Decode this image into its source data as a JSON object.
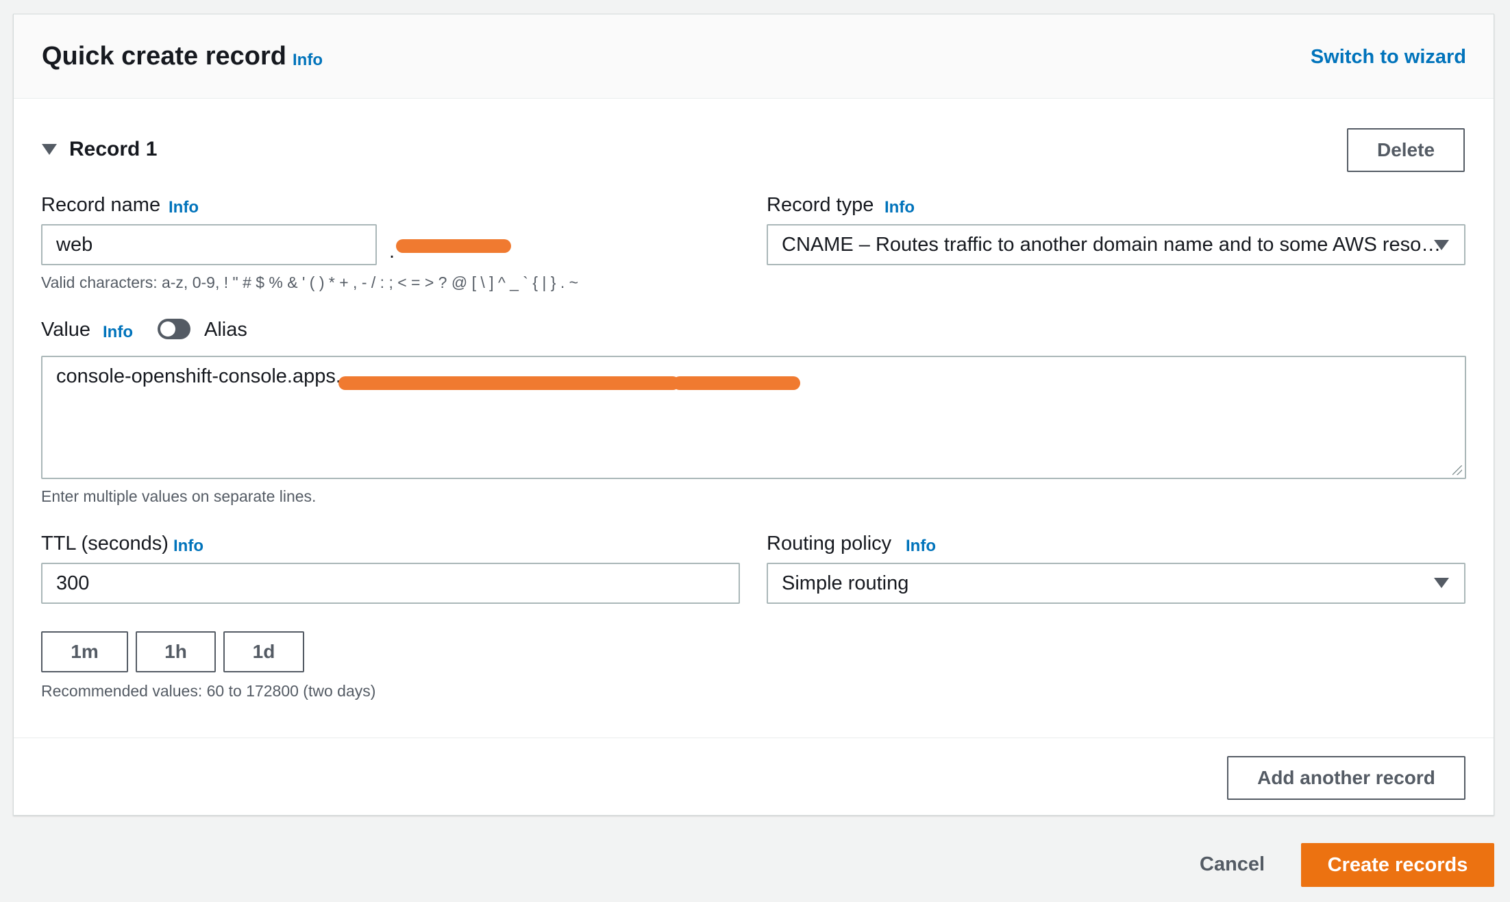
{
  "header": {
    "title": "Quick create record",
    "info": "Info",
    "switch_link": "Switch to wizard"
  },
  "record": {
    "heading": "Record 1",
    "delete_label": "Delete",
    "record_name": {
      "label": "Record name",
      "info": "Info",
      "value": "web",
      "domain_prefix": ".",
      "hint": "Valid characters: a-z, 0-9, ! \" # $ % & ' ( ) * + , - / : ; < = > ? @ [ \\ ] ^ _ ` { | } . ~"
    },
    "record_type": {
      "label": "Record type",
      "info": "Info",
      "value": "CNAME – Routes traffic to another domain name and to some AWS reso…"
    },
    "value_field": {
      "label": "Value",
      "info": "Info",
      "alias_label": "Alias",
      "alias_enabled": false,
      "value": "console-openshift-console.apps.",
      "hint": "Enter multiple values on separate lines."
    },
    "ttl": {
      "label": "TTL (seconds)",
      "info": "Info",
      "value": "300",
      "presets": [
        "1m",
        "1h",
        "1d"
      ],
      "hint": "Recommended values: 60 to 172800 (two days)"
    },
    "routing_policy": {
      "label": "Routing policy",
      "info": "Info",
      "value": "Simple routing"
    }
  },
  "footer": {
    "add_label": "Add another record"
  },
  "actions": {
    "cancel_label": "Cancel",
    "create_label": "Create records"
  },
  "colors": {
    "accent": "#ec7211",
    "link": "#0073bb",
    "redaction": "#f07a30"
  }
}
